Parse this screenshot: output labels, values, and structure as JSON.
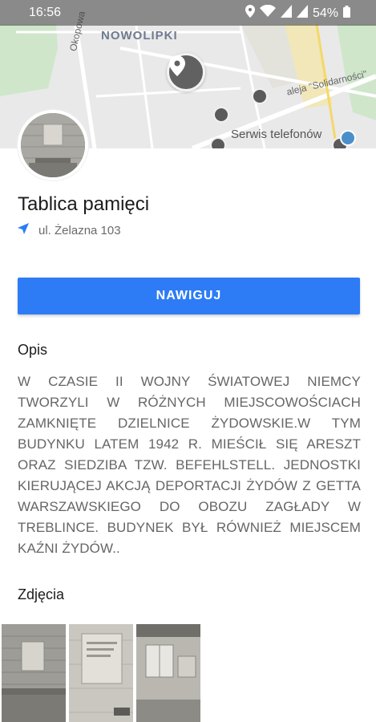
{
  "status_bar": {
    "time": "16:56",
    "battery": "54%",
    "icons": [
      "location-icon",
      "wifi-icon",
      "signal-icon",
      "signal-icon",
      "battery-icon"
    ]
  },
  "map": {
    "district_label": "NOWOLIPKI",
    "street_labels": [
      "Okopowa",
      "aleja \"Solidarności\""
    ],
    "poi_label": "Serwis telefonów"
  },
  "place": {
    "title": "Tablica pamięci",
    "address": "ul. Żelazna 103",
    "address_icon": "navigation-arrow-icon"
  },
  "actions": {
    "navigate_label": "NAWIGUJ"
  },
  "description": {
    "heading": "Opis",
    "text": "W CZASIE II WOJNY ŚWIATOWEJ NIEMCY TWORZYLI W RÓŻNYCH MIEJSCOWOŚCIACH ZAMKNIĘTE DZIELNICE ŻYDOWSKIE.W TYM BUDYNKU LATEM 1942 R. MIEŚCIŁ SIĘ ARESZT ORAZ SIEDZIBA TZW. BEFEHLSTELL. JEDNOSTKI KIERUJĄCEJ AKCJĄ DEPORTACJI ŻYDÓW Z GETTA WARSZAWSKIEGO DO OBOZU ZAGŁADY W TREBLINCE. BUDYNEK BYŁ RÓWNIEŻ MIEJSCEM KAŹNI ŻYDÓW.."
  },
  "photos": {
    "heading": "Zdjęcia",
    "count": 3
  },
  "colors": {
    "accent": "#2d7cf6",
    "map_bg": "#e9e9ea",
    "pin": "#616161"
  }
}
